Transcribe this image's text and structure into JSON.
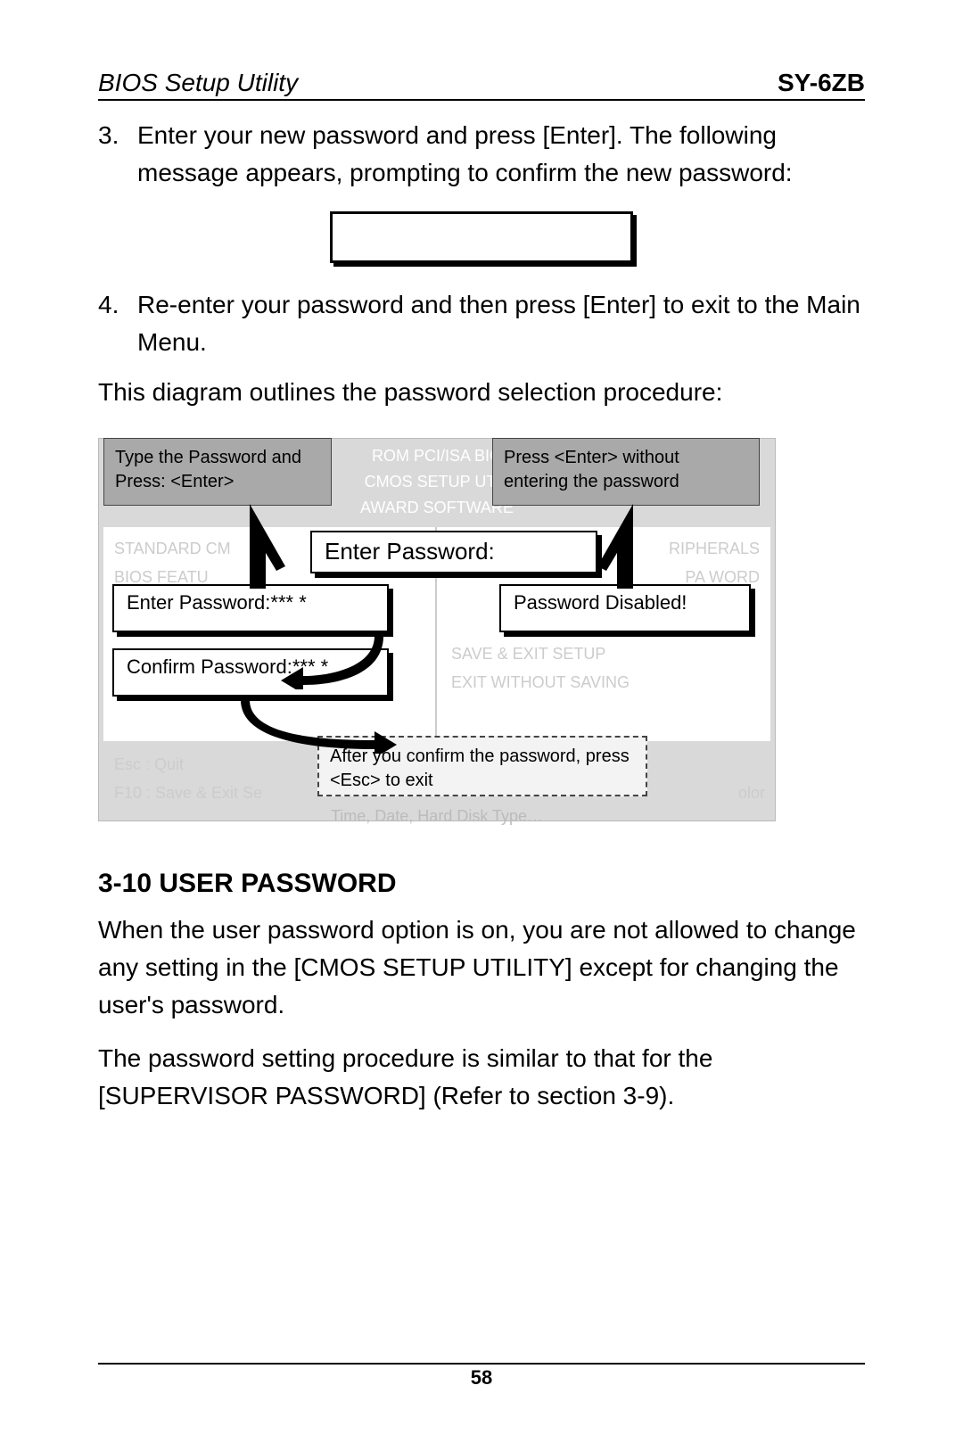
{
  "header": {
    "left": "BIOS Setup Utility",
    "right": "SY-6ZB"
  },
  "steps": {
    "s3_num": "3.",
    "s3_text": "Enter your new password and press [Enter]. The following message appears, prompting to confirm the new password:",
    "s4_num": "4.",
    "s4_text": "Re-enter your password and then press [Enter] to exit to the Main Menu."
  },
  "intro_para": "This diagram outlines the password selection procedure:",
  "diagram": {
    "bios_line1": "ROM PCI/ISA BIO",
    "bios_line2": "CMOS SETUP UTIL",
    "bios_line3": "AWARD SOFTWARE",
    "left_col_1": "STANDARD CM",
    "left_col_2": "BIOS FEATU",
    "left_col_3": " ",
    "right_col_1": "RIPHERALS",
    "right_col_2": "PA   WORD",
    "right_mid_1": "SAVE & EXIT SETUP",
    "right_mid_2": "EXIT WITHOUT SAVING",
    "footer_l1": "Esc   : Quit",
    "footer_l2": "F10  : Save & Exit Se",
    "footer_r1": "",
    "footer_r2": "olor",
    "footer_time": "Time, Date, Hard Disk Type…",
    "callout_tl": "Type the Password and Press: <Enter>",
    "callout_tr": "Press <Enter> without entering the password",
    "popup_title": "Enter Password:",
    "popup_enter": "Enter Password:*** *",
    "popup_confirm": "Confirm Password:*** *",
    "popup_disabled": "Password Disabled!",
    "callout_esc": "After you confirm the password, press <Esc> to exit"
  },
  "section": {
    "heading": "3-10  USER PASSWORD",
    "p1": "When the user password option is on, you are not allowed to change any setting in the [CMOS SETUP UTILITY] except for changing the user's password.",
    "p2": "The password setting procedure is similar to that for the [SUPERVISOR PASSWORD] (Refer to section 3-9)."
  },
  "page_number": "58"
}
